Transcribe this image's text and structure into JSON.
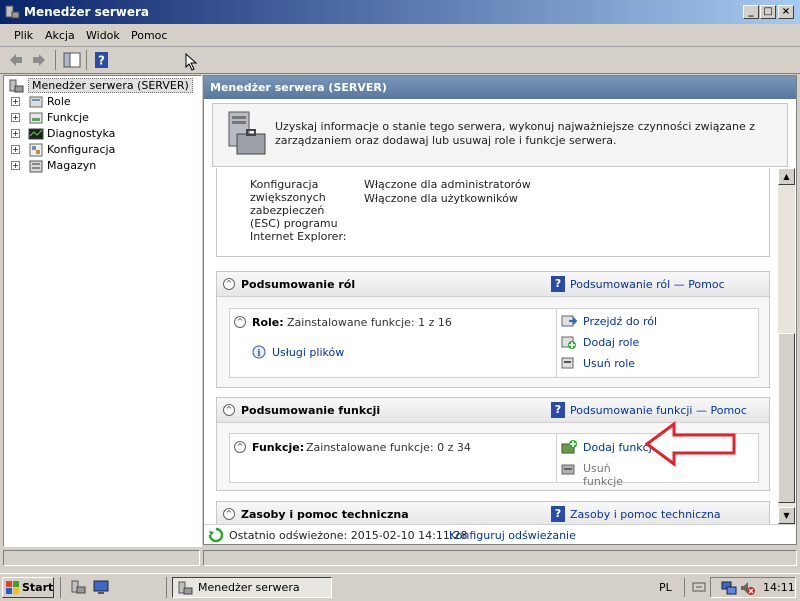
{
  "window": {
    "title": "Menedżer serwera"
  },
  "menu": [
    "Plik",
    "Akcja",
    "Widok",
    "Pomoc"
  ],
  "tree": {
    "root": "Menedżer serwera (SERVER)",
    "items": [
      "Role",
      "Funkcje",
      "Diagnostyka",
      "Konfiguracja",
      "Magazyn"
    ]
  },
  "main": {
    "header": "Menedżer serwera (SERVER)",
    "intro": "Uzyskaj informacje o stanie tego serwera, wykonuj najważniejsze czynności związane z zarządzaniem oraz dodawaj lub usuwaj role i funkcje serwera.",
    "esc": {
      "label_lines": [
        "Konfiguracja",
        "zwiększonych",
        "zabezpieczeń",
        "(ESC) programu",
        "Internet Explorer:"
      ],
      "values": [
        "Włączone dla administratorów",
        "Włączone dla użytkowników"
      ]
    },
    "roles_section": {
      "title": "Podsumowanie ról",
      "help": "Podsumowanie ról — Pomoc",
      "label": "Role:",
      "installed": "Zainstalowane funkcje: 1 z 16",
      "role_item": "Usługi plików",
      "actions": [
        "Przejdź do ról",
        "Dodaj role",
        "Usuń role"
      ]
    },
    "features_section": {
      "title": "Podsumowanie funkcji",
      "help": "Podsumowanie funkcji — Pomoc",
      "label": "Funkcje:",
      "installed": "Zainstalowane funkcje: 0 z 34",
      "actions": [
        "Dodaj funkcje",
        "Usuń funkcje"
      ]
    },
    "resources_section": {
      "title": "Zasoby i pomoc techniczna",
      "help": "Zasoby i pomoc techniczna"
    },
    "status": {
      "refreshed": "Ostatnio odświeżone: 2015-02-10 14:11:28",
      "configure": "Konfiguruj odświeżanie"
    }
  },
  "taskbar": {
    "start": "Start",
    "task": "Menedżer serwera",
    "lang": "PL",
    "time": "14:11"
  },
  "colors": {
    "accent_arrow": "#e8202a",
    "link": "#0033aa",
    "titlebar": "#0a246a"
  }
}
